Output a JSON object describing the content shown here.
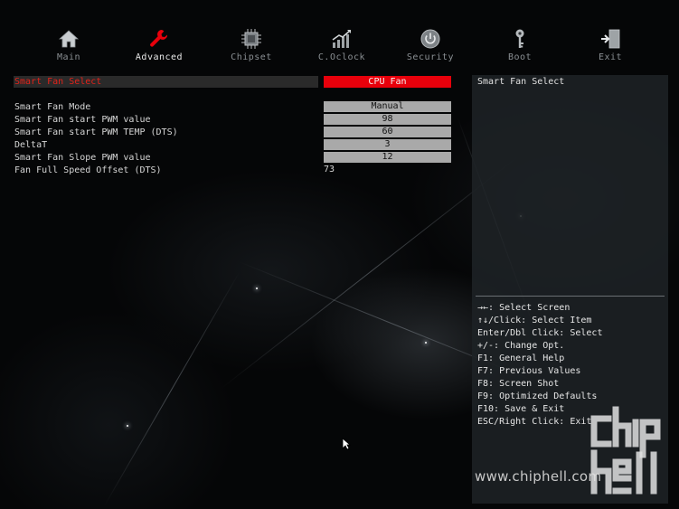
{
  "nav": {
    "items": [
      {
        "label": "Main",
        "icon": "home-icon"
      },
      {
        "label": "Advanced",
        "icon": "wrench-icon"
      },
      {
        "label": "Chipset",
        "icon": "chip-icon"
      },
      {
        "label": "C.Oclock",
        "icon": "chart-icon"
      },
      {
        "label": "Security",
        "icon": "power-shield-icon"
      },
      {
        "label": "Boot",
        "icon": "key-icon"
      },
      {
        "label": "Exit",
        "icon": "exit-door-icon"
      }
    ],
    "active": "Advanced"
  },
  "settings": {
    "selected": {
      "label": "Smart Fan Select",
      "value": "CPU Fan"
    },
    "rows": [
      {
        "label": "Smart Fan Mode",
        "value": "Manual"
      },
      {
        "label": "Smart Fan start PWM value",
        "value": "98"
      },
      {
        "label": "Smart Fan start PWM TEMP (DTS)",
        "value": "60"
      },
      {
        "label": "DeltaT",
        "value": "3"
      },
      {
        "label": "Smart Fan Slope PWM value",
        "value": "12"
      },
      {
        "label": "Fan Full Speed Offset (DTS)",
        "value": "73"
      }
    ]
  },
  "help": {
    "title": "Smart Fan Select",
    "keys": [
      "→←: Select Screen",
      "↑↓/Click: Select Item",
      "Enter/Dbl Click: Select",
      "+/-: Change Opt.",
      "F1: General Help",
      "F7: Previous Values",
      "F8: Screen Shot",
      "F9: Optimized Defaults",
      "F10: Save & Exit",
      "ESC/Right Click: Exit"
    ]
  },
  "watermark": {
    "url": "www.chiphell.com"
  },
  "colors": {
    "accent": "#e8000b",
    "value_box": "#a9a9a9",
    "panel": "#1e2226"
  }
}
